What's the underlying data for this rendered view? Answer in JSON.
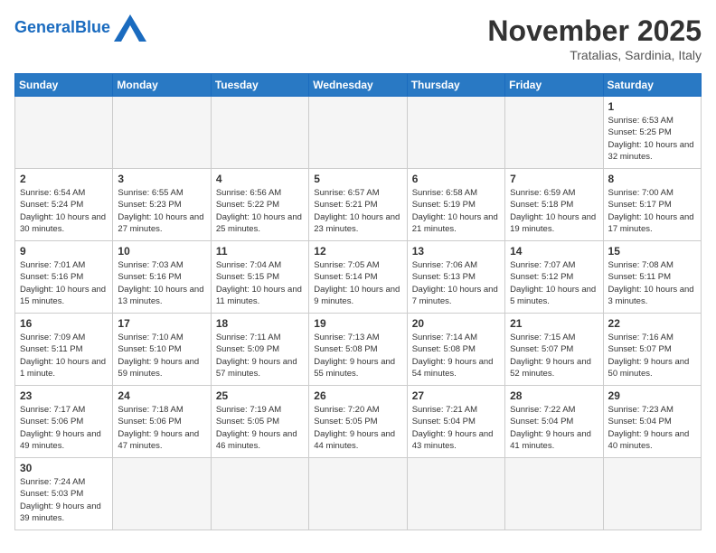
{
  "header": {
    "logo_general": "General",
    "logo_blue": "Blue",
    "month_title": "November 2025",
    "subtitle": "Tratalias, Sardinia, Italy"
  },
  "weekdays": [
    "Sunday",
    "Monday",
    "Tuesday",
    "Wednesday",
    "Thursday",
    "Friday",
    "Saturday"
  ],
  "weeks": [
    [
      {
        "day": "",
        "info": ""
      },
      {
        "day": "",
        "info": ""
      },
      {
        "day": "",
        "info": ""
      },
      {
        "day": "",
        "info": ""
      },
      {
        "day": "",
        "info": ""
      },
      {
        "day": "",
        "info": ""
      },
      {
        "day": "1",
        "info": "Sunrise: 6:53 AM\nSunset: 5:25 PM\nDaylight: 10 hours\nand 32 minutes."
      }
    ],
    [
      {
        "day": "2",
        "info": "Sunrise: 6:54 AM\nSunset: 5:24 PM\nDaylight: 10 hours\nand 30 minutes."
      },
      {
        "day": "3",
        "info": "Sunrise: 6:55 AM\nSunset: 5:23 PM\nDaylight: 10 hours\nand 27 minutes."
      },
      {
        "day": "4",
        "info": "Sunrise: 6:56 AM\nSunset: 5:22 PM\nDaylight: 10 hours\nand 25 minutes."
      },
      {
        "day": "5",
        "info": "Sunrise: 6:57 AM\nSunset: 5:21 PM\nDaylight: 10 hours\nand 23 minutes."
      },
      {
        "day": "6",
        "info": "Sunrise: 6:58 AM\nSunset: 5:19 PM\nDaylight: 10 hours\nand 21 minutes."
      },
      {
        "day": "7",
        "info": "Sunrise: 6:59 AM\nSunset: 5:18 PM\nDaylight: 10 hours\nand 19 minutes."
      },
      {
        "day": "8",
        "info": "Sunrise: 7:00 AM\nSunset: 5:17 PM\nDaylight: 10 hours\nand 17 minutes."
      }
    ],
    [
      {
        "day": "9",
        "info": "Sunrise: 7:01 AM\nSunset: 5:16 PM\nDaylight: 10 hours\nand 15 minutes."
      },
      {
        "day": "10",
        "info": "Sunrise: 7:03 AM\nSunset: 5:16 PM\nDaylight: 10 hours\nand 13 minutes."
      },
      {
        "day": "11",
        "info": "Sunrise: 7:04 AM\nSunset: 5:15 PM\nDaylight: 10 hours\nand 11 minutes."
      },
      {
        "day": "12",
        "info": "Sunrise: 7:05 AM\nSunset: 5:14 PM\nDaylight: 10 hours\nand 9 minutes."
      },
      {
        "day": "13",
        "info": "Sunrise: 7:06 AM\nSunset: 5:13 PM\nDaylight: 10 hours\nand 7 minutes."
      },
      {
        "day": "14",
        "info": "Sunrise: 7:07 AM\nSunset: 5:12 PM\nDaylight: 10 hours\nand 5 minutes."
      },
      {
        "day": "15",
        "info": "Sunrise: 7:08 AM\nSunset: 5:11 PM\nDaylight: 10 hours\nand 3 minutes."
      }
    ],
    [
      {
        "day": "16",
        "info": "Sunrise: 7:09 AM\nSunset: 5:11 PM\nDaylight: 10 hours\nand 1 minute."
      },
      {
        "day": "17",
        "info": "Sunrise: 7:10 AM\nSunset: 5:10 PM\nDaylight: 9 hours\nand 59 minutes."
      },
      {
        "day": "18",
        "info": "Sunrise: 7:11 AM\nSunset: 5:09 PM\nDaylight: 9 hours\nand 57 minutes."
      },
      {
        "day": "19",
        "info": "Sunrise: 7:13 AM\nSunset: 5:08 PM\nDaylight: 9 hours\nand 55 minutes."
      },
      {
        "day": "20",
        "info": "Sunrise: 7:14 AM\nSunset: 5:08 PM\nDaylight: 9 hours\nand 54 minutes."
      },
      {
        "day": "21",
        "info": "Sunrise: 7:15 AM\nSunset: 5:07 PM\nDaylight: 9 hours\nand 52 minutes."
      },
      {
        "day": "22",
        "info": "Sunrise: 7:16 AM\nSunset: 5:07 PM\nDaylight: 9 hours\nand 50 minutes."
      }
    ],
    [
      {
        "day": "23",
        "info": "Sunrise: 7:17 AM\nSunset: 5:06 PM\nDaylight: 9 hours\nand 49 minutes."
      },
      {
        "day": "24",
        "info": "Sunrise: 7:18 AM\nSunset: 5:06 PM\nDaylight: 9 hours\nand 47 minutes."
      },
      {
        "day": "25",
        "info": "Sunrise: 7:19 AM\nSunset: 5:05 PM\nDaylight: 9 hours\nand 46 minutes."
      },
      {
        "day": "26",
        "info": "Sunrise: 7:20 AM\nSunset: 5:05 PM\nDaylight: 9 hours\nand 44 minutes."
      },
      {
        "day": "27",
        "info": "Sunrise: 7:21 AM\nSunset: 5:04 PM\nDaylight: 9 hours\nand 43 minutes."
      },
      {
        "day": "28",
        "info": "Sunrise: 7:22 AM\nSunset: 5:04 PM\nDaylight: 9 hours\nand 41 minutes."
      },
      {
        "day": "29",
        "info": "Sunrise: 7:23 AM\nSunset: 5:04 PM\nDaylight: 9 hours\nand 40 minutes."
      }
    ],
    [
      {
        "day": "30",
        "info": "Sunrise: 7:24 AM\nSunset: 5:03 PM\nDaylight: 9 hours\nand 39 minutes."
      },
      {
        "day": "",
        "info": ""
      },
      {
        "day": "",
        "info": ""
      },
      {
        "day": "",
        "info": ""
      },
      {
        "day": "",
        "info": ""
      },
      {
        "day": "",
        "info": ""
      },
      {
        "day": "",
        "info": ""
      }
    ]
  ]
}
